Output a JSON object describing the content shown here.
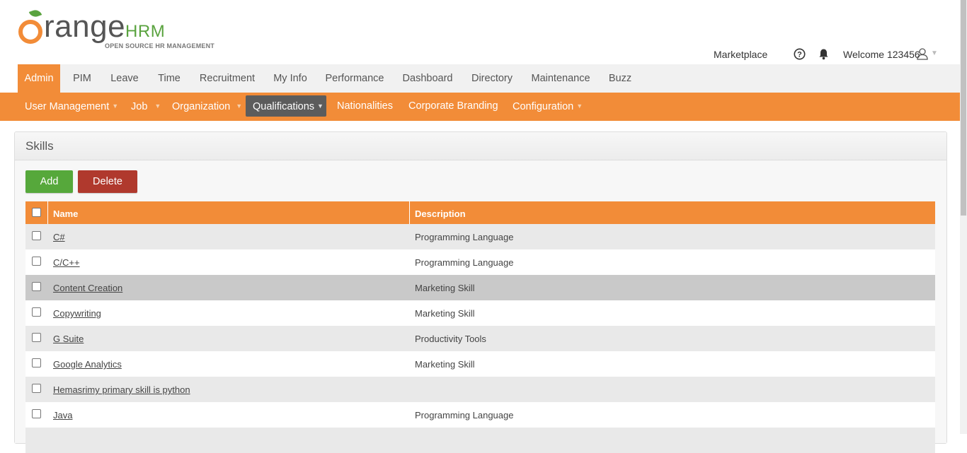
{
  "header": {
    "logo_main": "range",
    "logo_hrm": "HRM",
    "logo_tagline": "OPEN SOURCE HR MANAGEMENT",
    "marketplace": "Marketplace",
    "welcome": "Welcome 123456",
    "icons": [
      "help-icon",
      "bell-icon",
      "user-icon"
    ]
  },
  "main_menu": [
    {
      "label": "Admin",
      "active": true
    },
    {
      "label": "PIM"
    },
    {
      "label": "Leave"
    },
    {
      "label": "Time"
    },
    {
      "label": "Recruitment"
    },
    {
      "label": "My Info"
    },
    {
      "label": "Performance"
    },
    {
      "label": "Dashboard"
    },
    {
      "label": "Directory"
    },
    {
      "label": "Maintenance"
    },
    {
      "label": "Buzz"
    }
  ],
  "sub_menu": [
    {
      "label": "User Management",
      "caret": "▼"
    },
    {
      "label": "Job",
      "caret": "▼"
    },
    {
      "label": "Organization",
      "caret": "▼"
    },
    {
      "label": "Qualifications",
      "caret": "▼",
      "active": true
    },
    {
      "label": "Nationalities"
    },
    {
      "label": "Corporate Branding"
    },
    {
      "label": "Configuration",
      "caret": "▼"
    }
  ],
  "panel": {
    "title": "Skills",
    "add_label": "Add",
    "delete_label": "Delete"
  },
  "table": {
    "headers": {
      "name": "Name",
      "description": "Description"
    },
    "rows": [
      {
        "name": "C#",
        "description": "Programming Language"
      },
      {
        "name": "C/C++",
        "description": "Programming Language"
      },
      {
        "name": "Content Creation",
        "description": "Marketing Skill"
      },
      {
        "name": "Copywriting",
        "description": "Marketing Skill"
      },
      {
        "name": "G Suite",
        "description": "Productivity Tools"
      },
      {
        "name": "Google Analytics",
        "description": "Marketing Skill"
      },
      {
        "name": "Hemasrimy primary skill is python",
        "description": ""
      },
      {
        "name": "Java",
        "description": "Programming Language"
      }
    ]
  },
  "colors": {
    "accent": "#f28c38",
    "brand_green": "#5aa33f",
    "add_button": "#56a83b",
    "delete_button": "#b0392d",
    "active_submenu": "#5c5c5c"
  }
}
